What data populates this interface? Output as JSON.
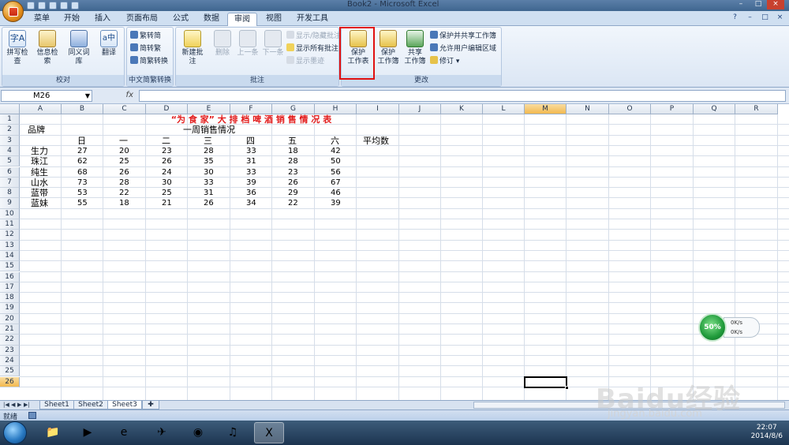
{
  "window": {
    "title": "Book2 - Microsoft Excel"
  },
  "tabs": [
    {
      "label": "菜单"
    },
    {
      "label": "开始"
    },
    {
      "label": "插入"
    },
    {
      "label": "页面布局"
    },
    {
      "label": "公式"
    },
    {
      "label": "数据"
    },
    {
      "label": "审阅"
    },
    {
      "label": "视图"
    },
    {
      "label": "开发工具"
    }
  ],
  "active_tab": "审阅",
  "ribbon": {
    "proofing": {
      "label": "校对",
      "spell": "拼写检查",
      "research": "信息检索",
      "thesaurus": "同义词库",
      "translate": "翻译"
    },
    "chinese": {
      "label": "中文简繁转换",
      "to_simplified": "繁转简",
      "to_traditional": "简转繁",
      "convert": "简繁转换"
    },
    "comments": {
      "label": "批注",
      "new": "新建批注",
      "delete": "删除",
      "prev": "上一条",
      "next": "下一条",
      "show_hide": "显示/隐藏批注",
      "show_all": "显示所有批注",
      "show_ink": "显示墨迹"
    },
    "changes": {
      "label": "更改",
      "protect_sheet_1": "保护",
      "protect_sheet_2": "工作表",
      "protect_book_1": "保护",
      "protect_book_2": "工作簿",
      "share_book_1": "共享",
      "share_book_2": "工作簿",
      "protect_share": "保护并共享工作簿",
      "allow_edit": "允许用户编辑区域",
      "track": "修订"
    }
  },
  "formula_bar": {
    "name_box": "M26",
    "fx": "fx",
    "value": ""
  },
  "columns": [
    "A",
    "B",
    "C",
    "D",
    "E",
    "F",
    "G",
    "H",
    "I",
    "J",
    "K",
    "L",
    "M",
    "N",
    "O",
    "P",
    "Q",
    "R"
  ],
  "selected_column": "M",
  "rows": [
    "1",
    "2",
    "3",
    "4",
    "5",
    "6",
    "7",
    "8",
    "9",
    "10",
    "11",
    "12",
    "13",
    "14",
    "15",
    "16",
    "17",
    "18",
    "19",
    "20",
    "21",
    "22",
    "23",
    "24",
    "25",
    "26"
  ],
  "selected_row": "26",
  "sheet": {
    "title": "“为 食 家” 大 排 档 啤 酒 销 售 情 况 表",
    "brand_header": "品牌",
    "week_header": "一周销售情况",
    "days": [
      "日",
      "一",
      "二",
      "三",
      "四",
      "五",
      "六"
    ],
    "avg_header": "平均数",
    "data": [
      {
        "brand": "生力",
        "values": [
          "27",
          "20",
          "23",
          "28",
          "33",
          "18",
          "42"
        ]
      },
      {
        "brand": "珠江",
        "values": [
          "62",
          "25",
          "26",
          "35",
          "31",
          "28",
          "50"
        ]
      },
      {
        "brand": "纯生",
        "values": [
          "68",
          "26",
          "24",
          "30",
          "33",
          "23",
          "56"
        ]
      },
      {
        "brand": "山水",
        "values": [
          "73",
          "28",
          "30",
          "33",
          "39",
          "26",
          "67"
        ]
      },
      {
        "brand": "蓝带",
        "values": [
          "53",
          "22",
          "25",
          "31",
          "36",
          "29",
          "46"
        ]
      },
      {
        "brand": "蓝妹",
        "values": [
          "55",
          "18",
          "21",
          "26",
          "34",
          "22",
          "39"
        ]
      }
    ]
  },
  "sheet_tabs": [
    "Sheet1",
    "Sheet2",
    "Sheet3"
  ],
  "active_sheet": "Sheet3",
  "status": {
    "text": "就绪"
  },
  "net_widget": {
    "percent": "50%",
    "up": "0K/s",
    "down": "0K/s"
  },
  "clock": {
    "time": "22:07",
    "date": "2014/8/6"
  },
  "watermark": {
    "text": "Baidu经验",
    "sub": "jingyan.baidu.com"
  },
  "colors": {
    "title_red": "#e21b1b",
    "highlight": "#e01010"
  }
}
